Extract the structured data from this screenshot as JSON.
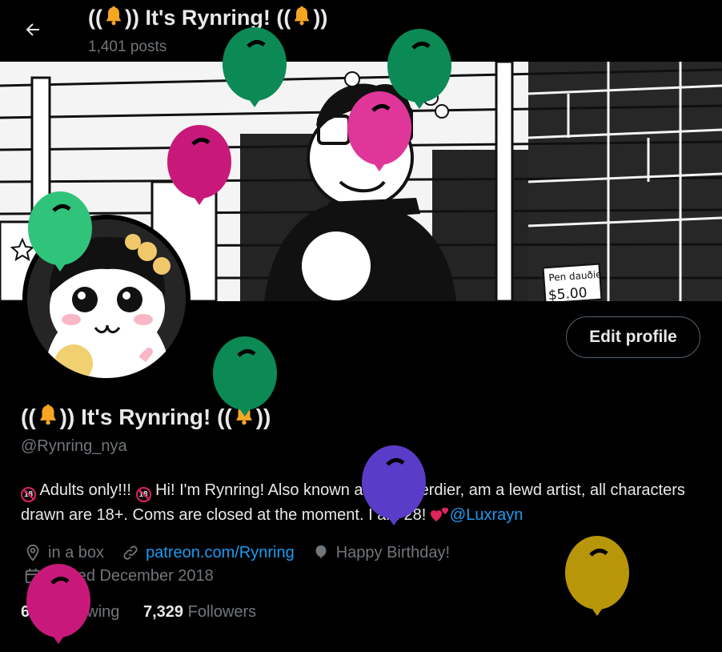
{
  "header": {
    "title_prefix": "((",
    "title_middle": ")) It's Rynring! ((",
    "title_suffix": "))",
    "posts_count": "1,401 posts"
  },
  "banner": {
    "price_tag_name": "Pen dauðie",
    "price_tag_price": "$5.00"
  },
  "profile": {
    "edit_button_label": "Edit profile",
    "name_prefix": "((",
    "name_middle": ")) It's Rynring! ((",
    "name_suffix": "))",
    "handle": "@Rynring_nya",
    "bio_part1": " Adults only!!! ",
    "bio_part2": " Hi! I'm Rynring! Also known as RymHerdier, am a lewd artist, all characters drawn are 18+. Coms are closed at the moment. I am 28! ",
    "bio_mention": "@Luxrayn",
    "location": "in a box",
    "website": "patreon.com/Rynring",
    "birthday": "Happy Birthday!",
    "joined": "Joined December 2018"
  },
  "stats": {
    "following_count": "639",
    "following_label": "Following",
    "followers_count": "7,329",
    "followers_label": "Followers"
  },
  "colors": {
    "accent": "#1d9bf0",
    "balloon_green": "#0b8a55",
    "balloon_pink": "#c8197a",
    "balloon_light_green": "#2fc47a",
    "balloon_purple": "#5a3cc8",
    "balloon_gold": "#b8960a"
  }
}
